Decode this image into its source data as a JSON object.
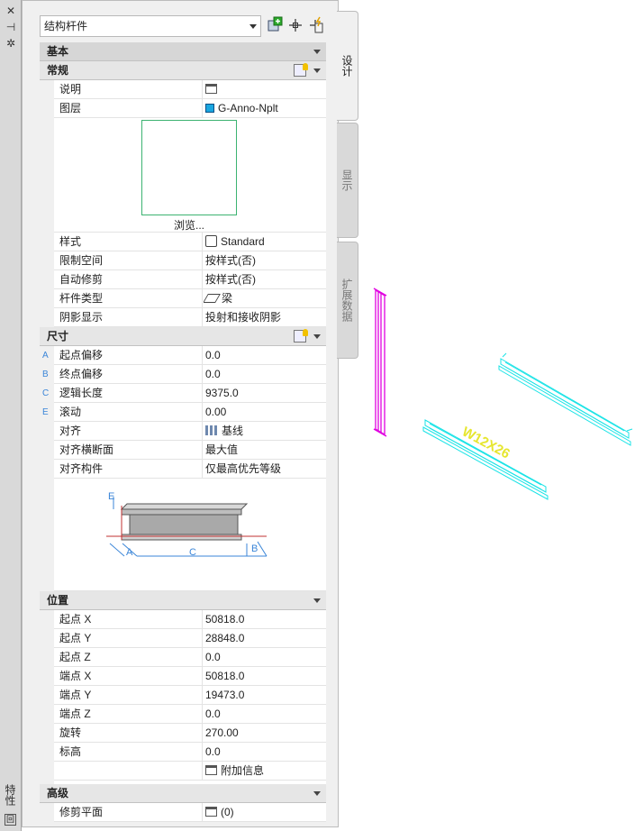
{
  "palette": {
    "title": "特性",
    "close": "✕",
    "pin": "⊣",
    "menu": "✲",
    "bottom": "回"
  },
  "selector": {
    "value": "结构杆件"
  },
  "toolbar": {
    "add_icon": "add-selection-icon",
    "select_icon": "select-objects-icon",
    "quick_icon": "quick-select-icon"
  },
  "tabs": {
    "design": "设计",
    "display": "显示",
    "ext": "扩展数据"
  },
  "sections": {
    "basic": "基本",
    "general": "常规",
    "dims": "尺寸",
    "location": "位置",
    "advanced": "高级"
  },
  "general": {
    "desc": {
      "label": "说明"
    },
    "layer": {
      "label": "图层",
      "value": "G-Anno-Nplt"
    },
    "browse": "浏览...",
    "style": {
      "label": "样式",
      "value": "Standard"
    },
    "bound": {
      "label": "限制空间",
      "value": "按样式(否)"
    },
    "autotrim": {
      "label": "自动修剪",
      "value": "按样式(否)"
    },
    "mtype": {
      "label": "杆件类型",
      "value": "梁"
    },
    "shadow": {
      "label": "阴影显示",
      "value": "投射和接收阴影"
    }
  },
  "dims": {
    "a": {
      "mk": "A",
      "label": "起点偏移",
      "value": "0.0"
    },
    "b": {
      "mk": "B",
      "label": "终点偏移",
      "value": "0.0"
    },
    "c": {
      "mk": "C",
      "label": "逻辑长度",
      "value": "9375.0"
    },
    "e": {
      "mk": "E",
      "label": "滚动",
      "value": "0.00"
    },
    "just": {
      "label": "对齐",
      "value": "基线"
    },
    "justsec": {
      "label": "对齐横断面",
      "value": "最大值"
    },
    "justmem": {
      "label": "对齐构件",
      "value": "仅最高优先等级"
    },
    "dlabels": {
      "a": "A",
      "b": "B",
      "c": "C",
      "e": "E"
    }
  },
  "location": {
    "sx": {
      "label": "起点 X",
      "value": "50818.0"
    },
    "sy": {
      "label": "起点 Y",
      "value": "28848.0"
    },
    "sz": {
      "label": "起点 Z",
      "value": "0.0"
    },
    "ex": {
      "label": "端点 X",
      "value": "50818.0"
    },
    "ey": {
      "label": "端点 Y",
      "value": "19473.0"
    },
    "ez": {
      "label": "端点 Z",
      "value": "0.0"
    },
    "rot": {
      "label": "旋转",
      "value": "270.00"
    },
    "elev": {
      "label": "标高",
      "value": "0.0"
    },
    "addinfo": "附加信息"
  },
  "advanced": {
    "clip": {
      "label": "修剪平面",
      "value": "(0)"
    }
  },
  "drawing": {
    "tag": "W12X26",
    "colors": {
      "magenta": "#e000e0",
      "cyan": "#19e3e6",
      "yellow": "#e6e62e"
    }
  }
}
